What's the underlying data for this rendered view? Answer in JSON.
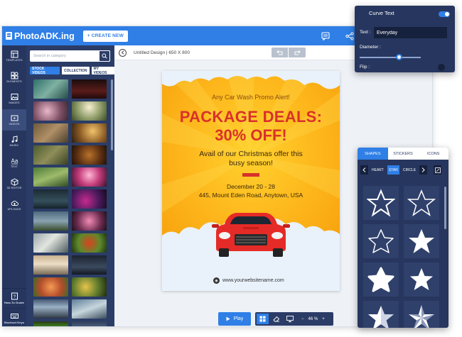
{
  "app": {
    "logo_text": "PhotoADK.ing",
    "create_button": "+ CREATE NEW"
  },
  "rail": {
    "items": [
      {
        "label": "TEMPLATES",
        "icon": "template-icon"
      },
      {
        "label": "ELEMENTS",
        "icon": "elements-icon"
      },
      {
        "label": "IMAGES",
        "icon": "image-icon"
      },
      {
        "label": "VIDEOS",
        "icon": "video-icon"
      },
      {
        "label": "MUSIC",
        "icon": "music-icon"
      },
      {
        "label": "TEXT",
        "icon": "text-icon"
      },
      {
        "label": "3D EDITOR",
        "icon": "cube-icon"
      },
      {
        "label": "UPLOADS",
        "icon": "upload-icon"
      }
    ],
    "bottom": [
      {
        "label": "How-To Guide",
        "icon": "guide-icon"
      },
      {
        "label": "Shortcut Keys",
        "icon": "keyboard-icon"
      }
    ]
  },
  "panel": {
    "search_placeholder": "Search in category",
    "tabs": [
      "STOCK VIDEOS",
      "COLLECTION",
      "MY VIDEOS"
    ]
  },
  "stage": {
    "doc_title": "Untitled Design | 650 X 800"
  },
  "poster": {
    "alert": "Any Car Wash Promo Alert!",
    "headline1": "PACKAGE DEALS:",
    "headline2": "30% OFF!",
    "offer1": "Avail of our Christmas offer this",
    "offer2": "busy season!",
    "dates": "December 20 - 28",
    "address": "445, Mount Eden Road, Anytown, USA",
    "website": "www.yourwebsitename.com"
  },
  "controls": {
    "play_label": "Play",
    "zoom": "46 %"
  },
  "curve_text": {
    "title": "Curve Text",
    "text_label": "Text :",
    "text_value": "Everyday",
    "diameter_label": "Diameter :",
    "diameter_level": 0.64,
    "flip_label": "Flip :",
    "enabled": true
  },
  "shapes_panel": {
    "tabs": [
      "SHAPES",
      "STICKERS",
      "ICONS"
    ],
    "filters": [
      "HEART",
      "STAR",
      "CIRCLE"
    ],
    "active_filter": "STAR"
  },
  "colors": {
    "brand_blue": "#2f7fe6",
    "navy": "#26365e",
    "poster_red": "#d9312a",
    "poster_yellow": "#fdb61b"
  }
}
